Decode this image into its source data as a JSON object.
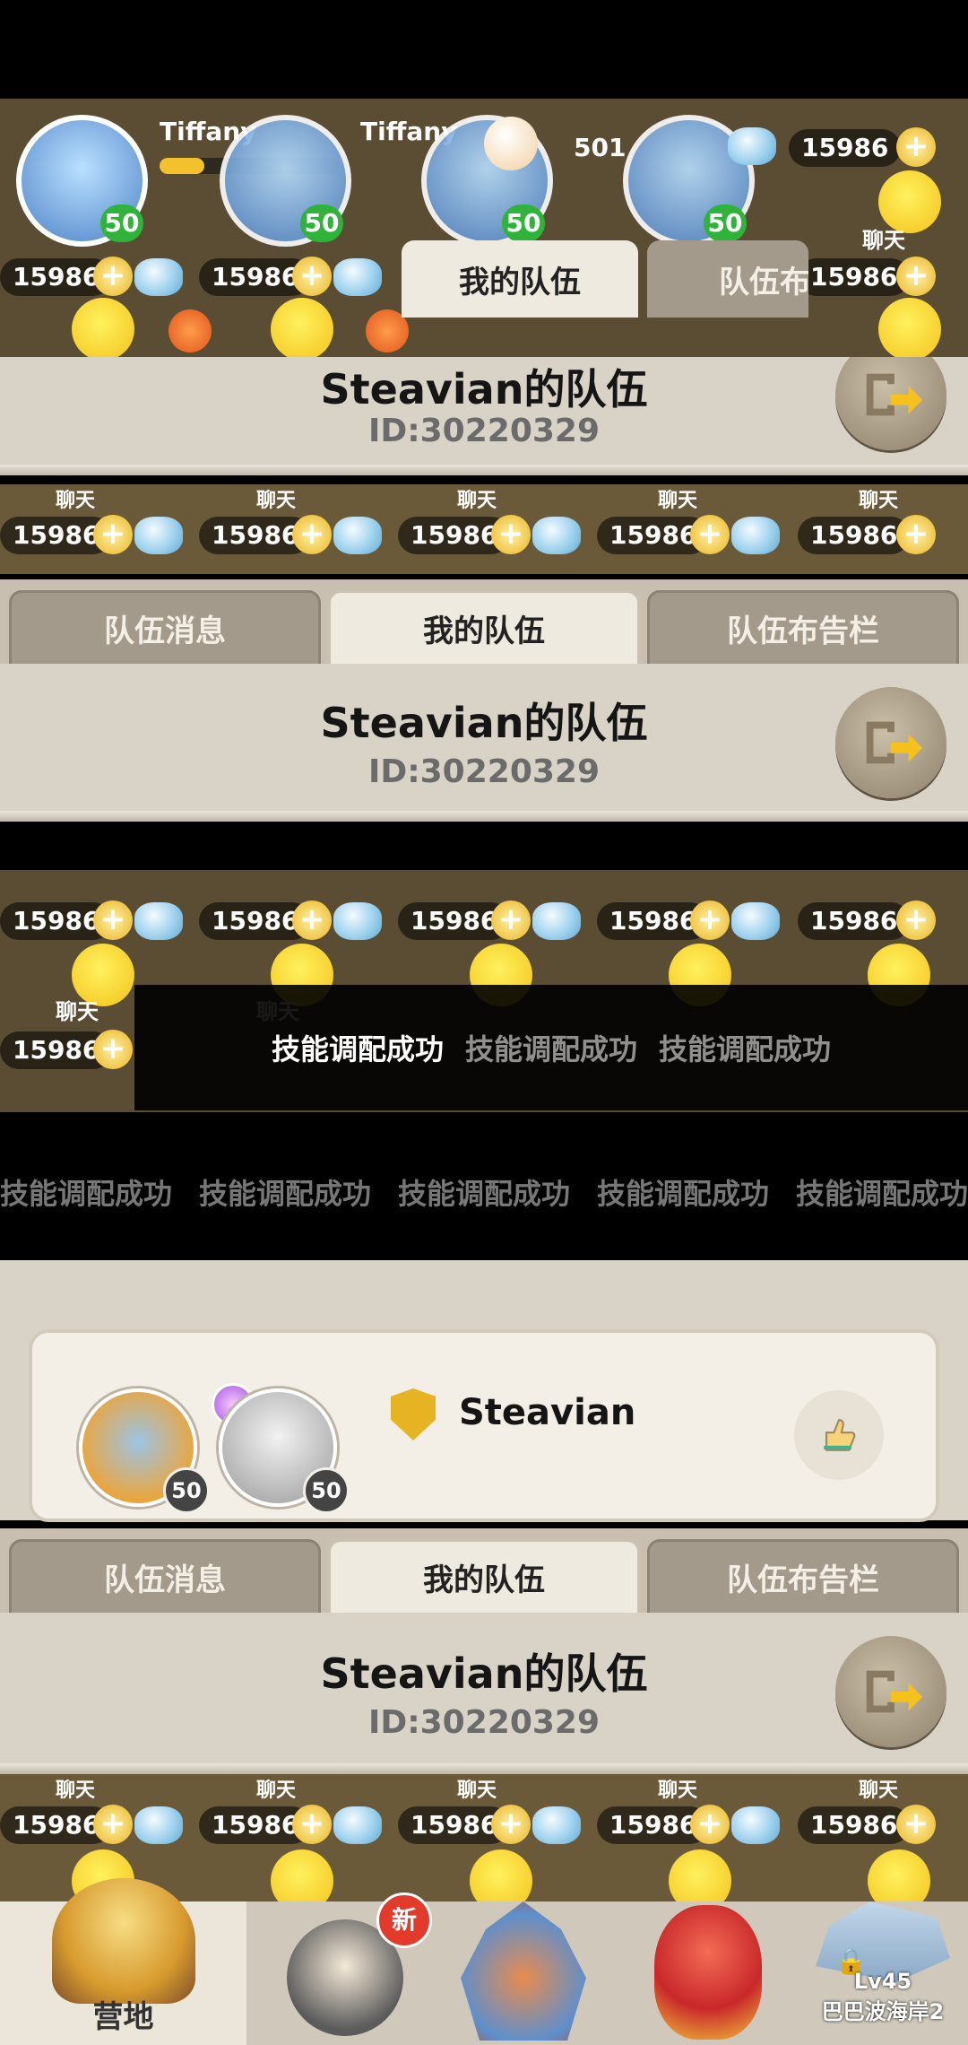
{
  "player": {
    "name": "Tiffany",
    "level": "50",
    "pearl_count": "501",
    "gem_count": "15986",
    "chat_label": "聊天",
    "location_prefix": "巴"
  },
  "tabs": [
    {
      "label": "队伍消息"
    },
    {
      "label": "我的队伍"
    },
    {
      "label": "队伍布告栏"
    }
  ],
  "team": {
    "title": "Steavian的队伍",
    "id": "ID:30220329"
  },
  "toast": {
    "message": "技能调配成功"
  },
  "member": {
    "name": "Steavian",
    "pet_level": "50",
    "hero_level": "50"
  },
  "bottom_nav": {
    "camp_label": "营地",
    "new_badge": "新",
    "locked_level": "Lv45",
    "locked_label": "巴巴波海岸2"
  },
  "colors": {
    "panel": "#d9d3c7",
    "tab_active": "#efeae0",
    "tab_inactive": "#a49a8b",
    "level_badge": "#2fb33a",
    "gold": "#e9b420"
  }
}
